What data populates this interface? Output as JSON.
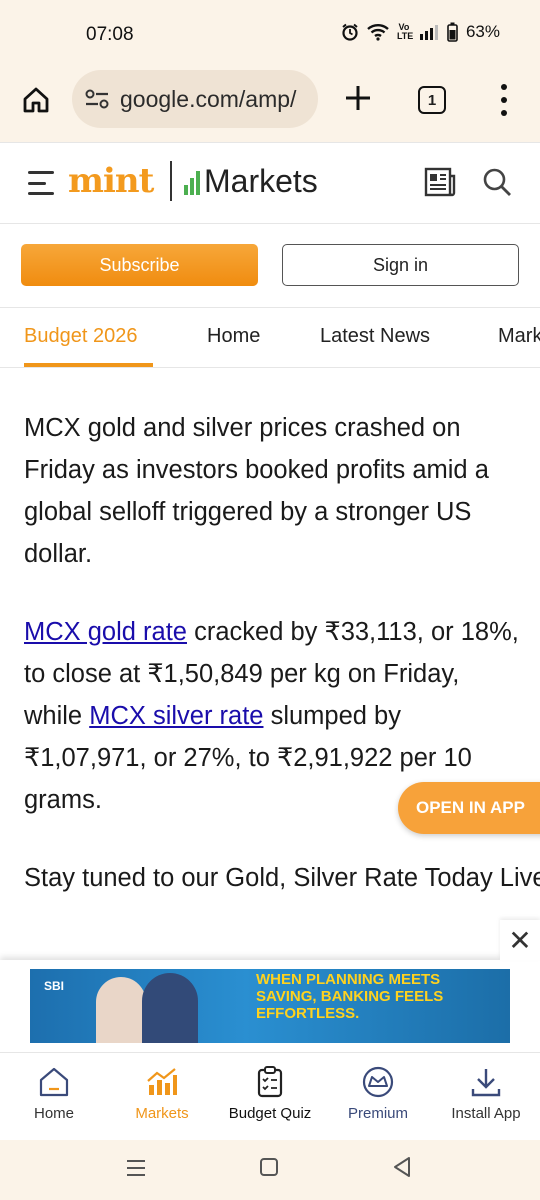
{
  "status_bar": {
    "time": "07:08",
    "battery": "63%",
    "network": "Vo LTE"
  },
  "browser": {
    "url": "google.com/amp/",
    "tab_count": "1"
  },
  "site": {
    "logo": "mint",
    "section_logo": "Markets",
    "brand_color": "#f0961a"
  },
  "auth": {
    "subscribe_label": "Subscribe",
    "signin_label": "Sign in"
  },
  "nav_tabs": [
    {
      "label": "Budget 2026",
      "active": true
    },
    {
      "label": "Home"
    },
    {
      "label": "Latest News"
    },
    {
      "label": "Markets"
    }
  ],
  "article": {
    "p1": "MCX gold and silver prices crashed on Friday as investors booked profits amid a global selloff triggered by a stronger US dollar.",
    "p2_link1": "MCX gold rate",
    "p2_part1": " cracked by ₹33,113, or 18%, to close at ₹1,50,849 per kg on Friday, while ",
    "p2_link2": "MCX silver rate",
    "p2_part2": " slumped by ₹1,07,971, or 27%, to ₹2,91,922 per 10 grams.",
    "p3": "Stay tuned to our Gold, Silver Rate Today Live Blog for the latest updates"
  },
  "open_app_label": "OPEN IN APP",
  "ad": {
    "brand": "SBI",
    "text": "WHEN PLANNING MEETS SAVING, BANKING FEELS EFFORTLESS.",
    "close_label": "✕"
  },
  "bottom_nav": [
    {
      "label": "Home",
      "icon": "home-icon"
    },
    {
      "label": "Markets",
      "icon": "markets-chart-icon",
      "active": true
    },
    {
      "label": "Budget Quiz",
      "icon": "quiz-clipboard-icon"
    },
    {
      "label": "Premium",
      "icon": "premium-crown-icon"
    },
    {
      "label": "Install App",
      "icon": "download-icon"
    }
  ]
}
